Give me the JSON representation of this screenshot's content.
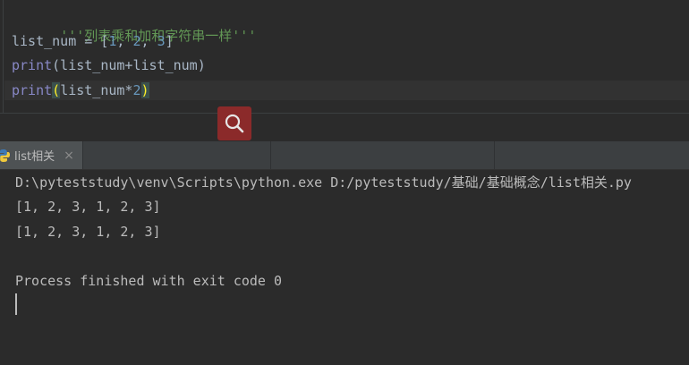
{
  "editor": {
    "lines": [
      {
        "doc": "'''列表乘和加和字符串一样'''"
      },
      {
        "prefix": "list_num = [",
        "n1": "1",
        "c1": ", ",
        "n2": "2",
        "c2": ", ",
        "n3": "3",
        "suffix": "]"
      },
      {
        "builtin": "print",
        "rest": "(list_num+list_num)"
      },
      {
        "builtin": "print",
        "open": "(",
        "mid": "list_num*",
        "num": "2",
        "close": ")"
      }
    ]
  },
  "search_button": {
    "icon": "search-icon",
    "color": "#8b2a2a"
  },
  "run_panel": {
    "tab_label": "list相关",
    "tab_icon": "python-icon",
    "close_symbol": "×"
  },
  "console": {
    "lines": [
      "D:\\pyteststudy\\venv\\Scripts\\python.exe D:/pyteststudy/基础/基础概念/list相关.py",
      "[1, 2, 3, 1, 2, 3]",
      "[1, 2, 3, 1, 2, 3]",
      "Process finished with exit code 0"
    ]
  }
}
